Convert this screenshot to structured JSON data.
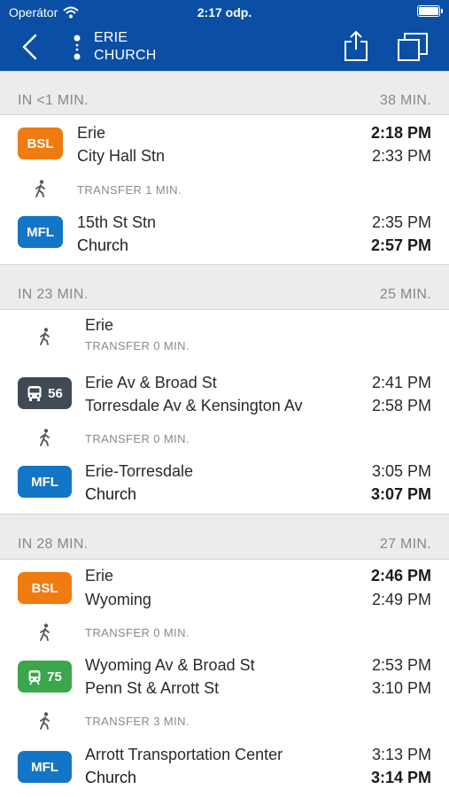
{
  "status_bar": {
    "carrier": "Operátor",
    "time": "2:17 odp."
  },
  "nav": {
    "origin": "ERIE",
    "destination": "CHURCH"
  },
  "trips": [
    {
      "starts": "IN <1 MIN.",
      "duration": "38 MIN.",
      "legs": [
        {
          "badge": "BSL",
          "from": "Erie",
          "to": "City Hall Stn",
          "dep": "2:18 PM",
          "arr": "2:33 PM"
        },
        {
          "transfer": "TRANSFER 1 MIN."
        },
        {
          "badge": "MFL",
          "from": "15th St Stn",
          "to": "Church",
          "dep": "2:35 PM",
          "arr": "2:57 PM"
        }
      ]
    },
    {
      "starts": "IN 23 MIN.",
      "duration": "25 MIN.",
      "legs": [
        {
          "walk_name": "Erie",
          "transfer": "TRANSFER 0 MIN."
        },
        {
          "badge": "56",
          "from": "Erie Av & Broad St",
          "to": "Torresdale Av & Kensington Av",
          "dep": "2:41 PM",
          "arr": "2:58 PM"
        },
        {
          "transfer": "TRANSFER 0 MIN."
        },
        {
          "badge": "MFL",
          "from": "Erie-Torresdale",
          "to": "Church",
          "dep": "3:05 PM",
          "arr": "3:07 PM"
        }
      ]
    },
    {
      "starts": "IN 28 MIN.",
      "duration": "27 MIN.",
      "legs": [
        {
          "badge": "BSL",
          "from": "Erie",
          "to": "Wyoming",
          "dep": "2:46 PM",
          "arr": "2:49 PM"
        },
        {
          "transfer": "TRANSFER 0 MIN."
        },
        {
          "badge": "75",
          "from": "Wyoming Av & Broad St",
          "to": "Penn St & Arrott St",
          "dep": "2:53 PM",
          "arr": "3:10 PM"
        },
        {
          "transfer": "TRANSFER 3 MIN."
        },
        {
          "badge": "MFL",
          "from": "Arrott Transportation Center",
          "to": "Church",
          "dep": "3:13 PM",
          "arr": "3:14 PM"
        }
      ]
    }
  ],
  "colors": {
    "header": "#0a4fa3",
    "bsl": "#f07b10",
    "mfl": "#1275c6",
    "bus_56": "#3f4a55",
    "trolley_75": "#3ba64b"
  }
}
